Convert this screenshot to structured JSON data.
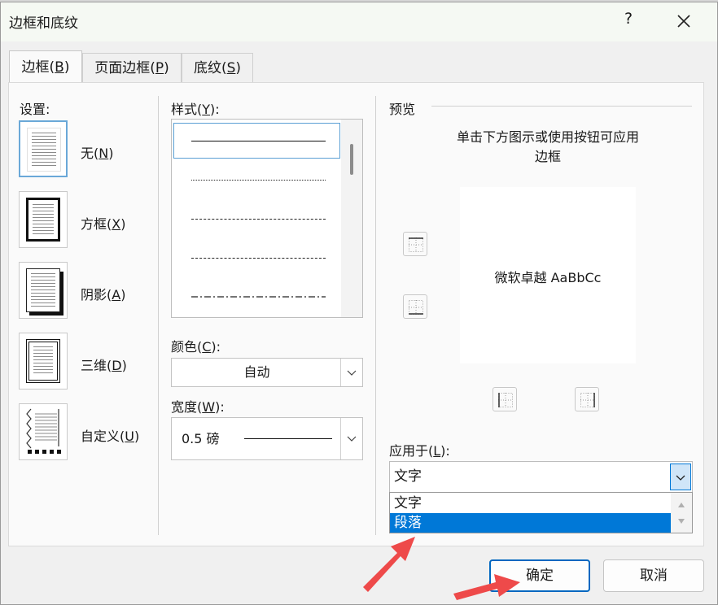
{
  "window": {
    "title": "边框和底纹",
    "help": "?"
  },
  "tabs": [
    {
      "label": "边框(",
      "key": "B",
      "end": ")"
    },
    {
      "label": "页面边框(",
      "key": "P",
      "end": ")"
    },
    {
      "label": "底纹(",
      "key": "S",
      "end": ")"
    }
  ],
  "settings": {
    "heading": "设置:",
    "items": [
      {
        "label": "无(",
        "key": "N",
        "end": ")"
      },
      {
        "label": "方框(",
        "key": "X",
        "end": ")"
      },
      {
        "label": "阴影(",
        "key": "A",
        "end": ")"
      },
      {
        "label": "三维(",
        "key": "D",
        "end": ")"
      },
      {
        "label": "自定义(",
        "key": "U",
        "end": ")"
      }
    ]
  },
  "style": {
    "heading": "样式(",
    "key": "Y",
    "end": "):",
    "line_styles": [
      "solid",
      "dotted",
      "dashed-fine",
      "dashed",
      "dash-dot"
    ]
  },
  "color": {
    "heading": "颜色(",
    "key": "C",
    "end": "):",
    "value": "自动"
  },
  "width": {
    "heading": "宽度(",
    "key": "W",
    "end": "):",
    "value": "0.5 磅"
  },
  "preview": {
    "heading": "预览",
    "instruction_line1": "单击下方图示或使用按钮可应用",
    "instruction_line2": "边框",
    "sample_text": "微软卓越  AaBbCc"
  },
  "apply_to": {
    "heading": "应用于(",
    "key": "L",
    "end": "):",
    "value": "文字",
    "options": [
      "文字",
      "段落"
    ],
    "highlighted": "段落"
  },
  "buttons": {
    "ok": "确定",
    "cancel": "取消"
  },
  "colors": {
    "accent": "#0078d7",
    "annotation_arrow": "#ee4a4a"
  }
}
